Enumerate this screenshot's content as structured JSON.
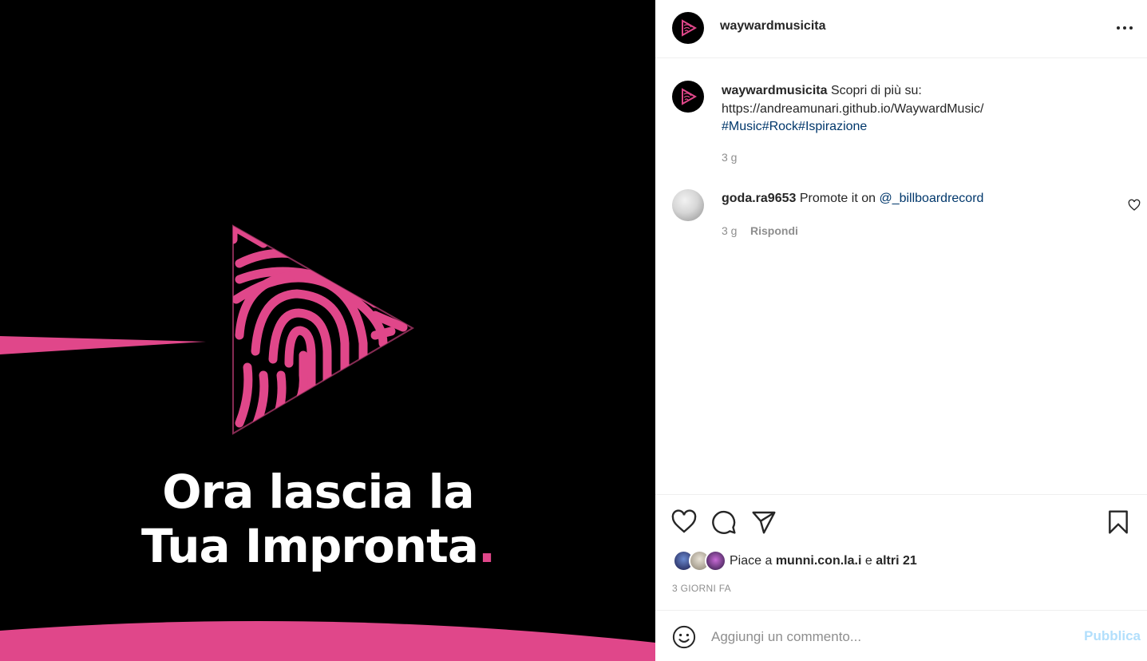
{
  "colors": {
    "brand_pink": "#e0478a",
    "link_blue": "#00376b",
    "publish_disabled": "#b2dffc"
  },
  "media": {
    "slogan_line1": "Ora lascia la",
    "slogan_line2": "Tua Impronta",
    "slogan_dot": "."
  },
  "post": {
    "username": "waywardmusicita",
    "more_icon": "more-horizontal-icon"
  },
  "caption": {
    "username": "waywardmusicita",
    "text": "Scopri di più su:",
    "url": "https://andreamunari.github.io/WaywardMusic/",
    "hashtags": [
      "#Music",
      "#Rock",
      "#Ispirazione"
    ],
    "time": "3 g"
  },
  "comments": [
    {
      "username": "goda.ra9653",
      "text": "Promote it on",
      "mention": "@_billboardrecord",
      "time": "3 g",
      "reply_label": "Rispondi"
    }
  ],
  "actions": {
    "icons": [
      "heart-icon",
      "comment-icon",
      "share-icon",
      "bookmark-icon"
    ]
  },
  "likes": {
    "prefix": "Piace a",
    "user": "munni.con.la.i",
    "conj": "e",
    "others": "altri 21"
  },
  "date": "3 GIORNI FA",
  "add_comment": {
    "placeholder": "Aggiungi un commento...",
    "publish_label": "Pubblica"
  }
}
